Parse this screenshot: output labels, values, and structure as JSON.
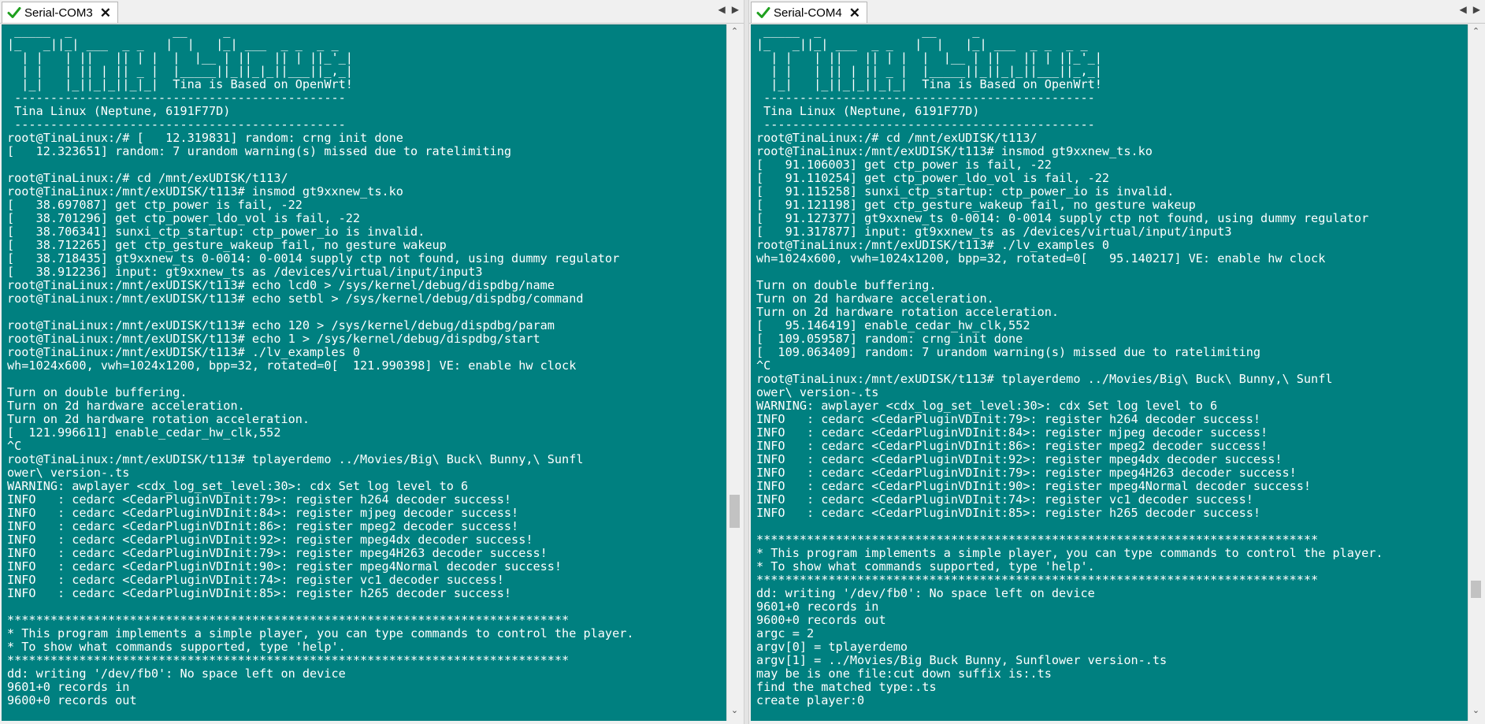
{
  "colors": {
    "terminal_bg": "#008080",
    "terminal_fg": "#ffffff",
    "tab_check": "#1fa01f"
  },
  "icons": {
    "tab_status": "check-icon",
    "tab_close": "close-icon",
    "scroll_up": "up-arrow-icon",
    "scroll_down": "down-arrow-icon",
    "nav_left": "left-arrow-icon",
    "nav_right": "right-arrow-icon"
  },
  "left": {
    "tab": {
      "title": "Serial-COM3",
      "close": "✕"
    },
    "nav": {
      "prev": "◀",
      "next": "▶"
    },
    "scroll": {
      "up": "⌃",
      "down": "⌄"
    },
    "log": " _____  _              __     _\n|_   _||_| ___  _ _   |  |   |_| ___  _ _  _ _\n  | |   | ||   || | |  |  |__ | ||   || | ||_'_|\n  | |   | || | || _ |  |_____||_||_|_||___||_,_|\n  |_|   |_||_|_||_|_|  Tina is Based on OpenWrt!\n ----------------------------------------------\n Tina Linux (Neptune, 6191F77D)\n ----------------------------------------------\nroot@TinaLinux:/# [   12.319831] random: crng init done\n[   12.323651] random: 7 urandom warning(s) missed due to ratelimiting\n\nroot@TinaLinux:/# cd /mnt/exUDISK/t113/\nroot@TinaLinux:/mnt/exUDISK/t113# insmod gt9xxnew_ts.ko\n[   38.697087] get ctp_power is fail, -22\n[   38.701296] get ctp_power_ldo_vol is fail, -22\n[   38.706341] sunxi_ctp_startup: ctp_power_io is invalid.\n[   38.712265] get ctp_gesture_wakeup fail, no gesture wakeup\n[   38.718435] gt9xxnew_ts 0-0014: 0-0014 supply ctp not found, using dummy regulator\n[   38.912236] input: gt9xxnew_ts as /devices/virtual/input/input3\nroot@TinaLinux:/mnt/exUDISK/t113# echo lcd0 > /sys/kernel/debug/dispdbg/name\nroot@TinaLinux:/mnt/exUDISK/t113# echo setbl > /sys/kernel/debug/dispdbg/command\n\nroot@TinaLinux:/mnt/exUDISK/t113# echo 120 > /sys/kernel/debug/dispdbg/param\nroot@TinaLinux:/mnt/exUDISK/t113# echo 1 > /sys/kernel/debug/dispdbg/start\nroot@TinaLinux:/mnt/exUDISK/t113# ./lv_examples 0\nwh=1024x600, vwh=1024x1200, bpp=32, rotated=0[  121.990398] VE: enable hw clock\n\nTurn on double buffering.\nTurn on 2d hardware acceleration.\nTurn on 2d hardware rotation acceleration.\n[  121.996611] enable_cedar_hw_clk,552\n^C\nroot@TinaLinux:/mnt/exUDISK/t113# tplayerdemo ../Movies/Big\\ Buck\\ Bunny,\\ Sunfl\nower\\ version-.ts\nWARNING: awplayer <cdx_log_set_level:30>: cdx Set log level to 6\nINFO   : cedarc <CedarPluginVDInit:79>: register h264 decoder success!\nINFO   : cedarc <CedarPluginVDInit:84>: register mjpeg decoder success!\nINFO   : cedarc <CedarPluginVDInit:86>: register mpeg2 decoder success!\nINFO   : cedarc <CedarPluginVDInit:92>: register mpeg4dx decoder success!\nINFO   : cedarc <CedarPluginVDInit:79>: register mpeg4H263 decoder success!\nINFO   : cedarc <CedarPluginVDInit:90>: register mpeg4Normal decoder success!\nINFO   : cedarc <CedarPluginVDInit:74>: register vc1 decoder success!\nINFO   : cedarc <CedarPluginVDInit:85>: register h265 decoder success!\n\n******************************************************************************\n* This program implements a simple player, you can type commands to control the player.\n* To show what commands supported, type 'help'.\n******************************************************************************\ndd: writing '/dev/fb0': No space left on device\n9601+0 records in\n9600+0 records out"
  },
  "right": {
    "tab": {
      "title": "Serial-COM4",
      "close": "✕"
    },
    "nav": {
      "prev": "◀",
      "next": "▶"
    },
    "scroll": {
      "up": "⌃",
      "down": "⌄"
    },
    "log": " _____  _              __     _\n|_   _||_| ___  _ _   |  |   |_| ___  _ _  _ _\n  | |   | ||   || | |  |  |__ | ||   || | ||_'_|\n  | |   | || | || _ |  |_____||_||_|_||___||_,_|\n  |_|   |_||_|_||_|_|  Tina is Based on OpenWrt!\n ----------------------------------------------\n Tina Linux (Neptune, 6191F77D)\n ----------------------------------------------\nroot@TinaLinux:/# cd /mnt/exUDISK/t113/\nroot@TinaLinux:/mnt/exUDISK/t113# insmod gt9xxnew_ts.ko\n[   91.106003] get ctp_power is fail, -22\n[   91.110254] get ctp_power_ldo_vol is fail, -22\n[   91.115258] sunxi_ctp_startup: ctp_power_io is invalid.\n[   91.121198] get ctp_gesture_wakeup fail, no gesture wakeup\n[   91.127377] gt9xxnew_ts 0-0014: 0-0014 supply ctp not found, using dummy regulator\n[   91.317877] input: gt9xxnew_ts as /devices/virtual/input/input3\nroot@TinaLinux:/mnt/exUDISK/t113# ./lv_examples 0\nwh=1024x600, vwh=1024x1200, bpp=32, rotated=0[   95.140217] VE: enable hw clock\n\nTurn on double buffering.\nTurn on 2d hardware acceleration.\nTurn on 2d hardware rotation acceleration.\n[   95.146419] enable_cedar_hw_clk,552\n[  109.059587] random: crng init done\n[  109.063409] random: 7 urandom warning(s) missed due to ratelimiting\n^C\nroot@TinaLinux:/mnt/exUDISK/t113# tplayerdemo ../Movies/Big\\ Buck\\ Bunny,\\ Sunfl\nower\\ version-.ts\nWARNING: awplayer <cdx_log_set_level:30>: cdx Set log level to 6\nINFO   : cedarc <CedarPluginVDInit:79>: register h264 decoder success!\nINFO   : cedarc <CedarPluginVDInit:84>: register mjpeg decoder success!\nINFO   : cedarc <CedarPluginVDInit:86>: register mpeg2 decoder success!\nINFO   : cedarc <CedarPluginVDInit:92>: register mpeg4dx decoder success!\nINFO   : cedarc <CedarPluginVDInit:79>: register mpeg4H263 decoder success!\nINFO   : cedarc <CedarPluginVDInit:90>: register mpeg4Normal decoder success!\nINFO   : cedarc <CedarPluginVDInit:74>: register vc1 decoder success!\nINFO   : cedarc <CedarPluginVDInit:85>: register h265 decoder success!\n\n******************************************************************************\n* This program implements a simple player, you can type commands to control the player.\n* To show what commands supported, type 'help'.\n******************************************************************************\ndd: writing '/dev/fb0': No space left on device\n9601+0 records in\n9600+0 records out\nargc = 2\nargv[0] = tplayerdemo\nargv[1] = ../Movies/Big Buck Bunny, Sunflower version-.ts\nmay be is one file:cut down suffix is:.ts\nfind the matched type:.ts\ncreate player:0"
  }
}
